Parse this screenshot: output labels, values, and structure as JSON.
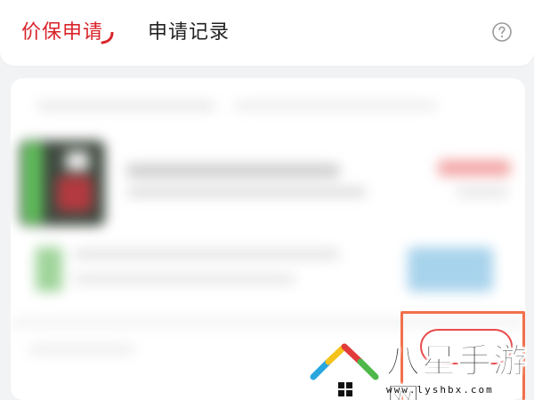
{
  "tabs": [
    {
      "label": "价保申请",
      "active": true
    },
    {
      "label": "申请记录",
      "active": false
    }
  ],
  "colors": {
    "accent": "#d9232a",
    "highlight_outline": "#f2704a",
    "background": "#f2f3f5"
  },
  "icons": {
    "help": "question-circle-icon"
  },
  "watermark": {
    "brand": "八星手游网",
    "url": "www.lyshbx.com"
  }
}
